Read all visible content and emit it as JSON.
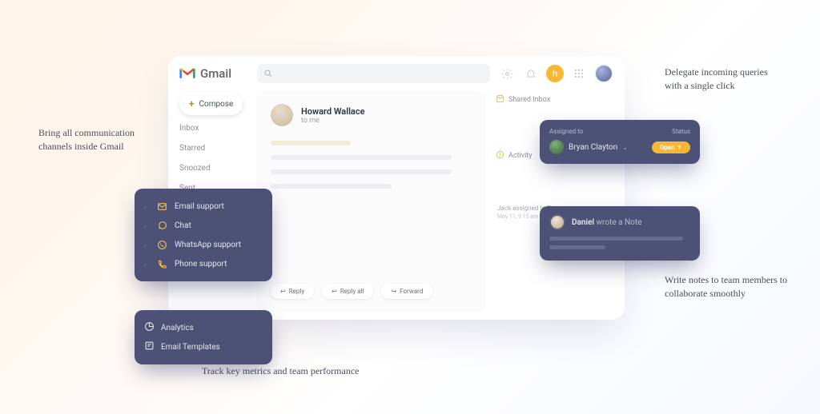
{
  "brand": {
    "name": "Gmail"
  },
  "annotations": {
    "left": "Bring all communication channels inside Gmail",
    "topright": "Delegate incoming queries with a single click",
    "bottomright": "Write notes to team members to collaborate smoothly",
    "bottom": "Track key metrics and team performance"
  },
  "compose": {
    "label": "Compose"
  },
  "nav": {
    "inbox": "Inbox",
    "starred": "Starred",
    "snoozed": "Snoozed",
    "sent": "Sent"
  },
  "message": {
    "from": "Howard Wallace",
    "to": "to me"
  },
  "actions": {
    "reply": "Reply",
    "reply_all": "Reply all",
    "forward": "Forward"
  },
  "shared_inbox": {
    "title": "Shared Inbox",
    "assigned_label": "Assigned to",
    "status_label": "Status",
    "assignee": "Bryan Clayton",
    "status": "Open"
  },
  "activity": {
    "title": "Activity",
    "note_author": "Daniel",
    "note_verb": "wrote a Note",
    "log_text": "Jack assigned to Bryan",
    "log_time": "May 11, 9:15 am"
  },
  "channels": {
    "email": "Email support",
    "chat": "Chat",
    "whatsapp": "WhatsApp support",
    "phone": "Phone support"
  },
  "tools": {
    "analytics": "Analytics",
    "templates": "Email Templates"
  }
}
